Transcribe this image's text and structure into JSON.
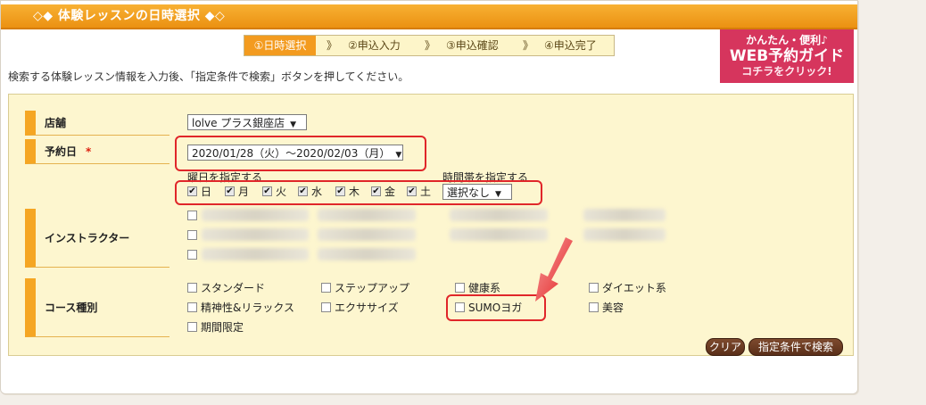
{
  "title": "◇◆ 体験レッスンの日時選択 ◆◇",
  "steps": [
    "①日時選択",
    "》",
    "②申込入力",
    "》",
    "③申込確認",
    "》",
    "④申込完了"
  ],
  "guide": {
    "line1": "かんたん・便利♪",
    "line2": "WEB予約ガイド",
    "line3": "コチラをクリック!"
  },
  "instruction": "検索する体験レッスン情報を入力後、「指定条件で検索」ボタンを押してください。",
  "store": {
    "label": "店舗",
    "value": "lolve プラス銀座店"
  },
  "reserve": {
    "label": "予約日",
    "required": "*",
    "value": "2020/01/28（火）～2020/02/03（月）"
  },
  "weekday": {
    "label": "曜日を指定する",
    "days": [
      "日",
      "月",
      "火",
      "水",
      "木",
      "金",
      "土"
    ]
  },
  "timeslot": {
    "label": "時間帯を指定する",
    "value": "選択なし"
  },
  "instructor": {
    "label": "インストラクター"
  },
  "course": {
    "label": "コース種別",
    "options": [
      "スタンダード",
      "ステップアップ",
      "健康系",
      "ダイエット系",
      "精神性&リラックス",
      "エクササイズ",
      "SUMOヨガ",
      "美容",
      "期間限定"
    ]
  },
  "buttons": {
    "clear": "クリア",
    "search": "指定条件で検索"
  },
  "colors": {
    "accent": "#f5a623",
    "panel": "#fdf6cf",
    "highlight": "#e0262a",
    "guide": "#d6355d"
  }
}
